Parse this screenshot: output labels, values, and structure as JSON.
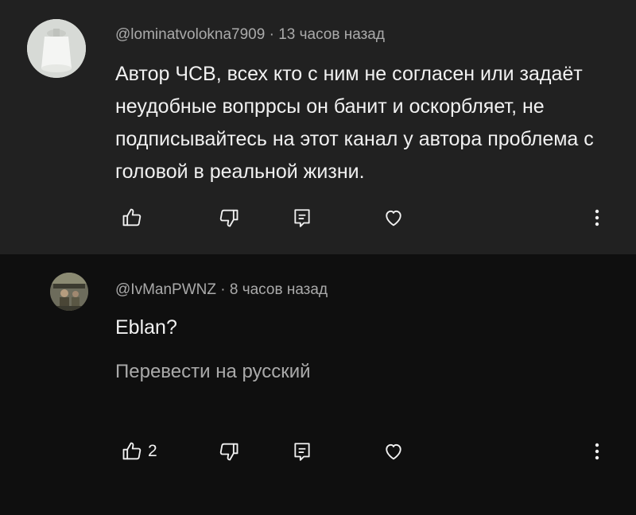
{
  "comments": [
    {
      "author": "@lominatvolokna7909",
      "time": "13 часов назад",
      "text": "Автор ЧСВ, всех кто с ним не согласен или задаёт неудобные вопррсы он банит и оскорбляет, не подписывайтесь на этот канал у автора проблема с головой в реальной жизни.",
      "likes": "",
      "translate": ""
    },
    {
      "author": "@IvManPWNZ",
      "time": "8 часов назад",
      "text": "Eblan?",
      "likes": "2",
      "translate": "Перевести на русский"
    }
  ],
  "separator": " · ",
  "icons": {
    "like": "thumb-up-icon",
    "dislike": "thumb-down-icon",
    "reply": "reply-icon",
    "heart": "heart-icon",
    "more": "more-vert-icon"
  },
  "colors": {
    "background_top": "#212121",
    "background_bottom": "#0f0f0f",
    "text": "#f1f1f1",
    "secondary": "#aaaaaa"
  }
}
